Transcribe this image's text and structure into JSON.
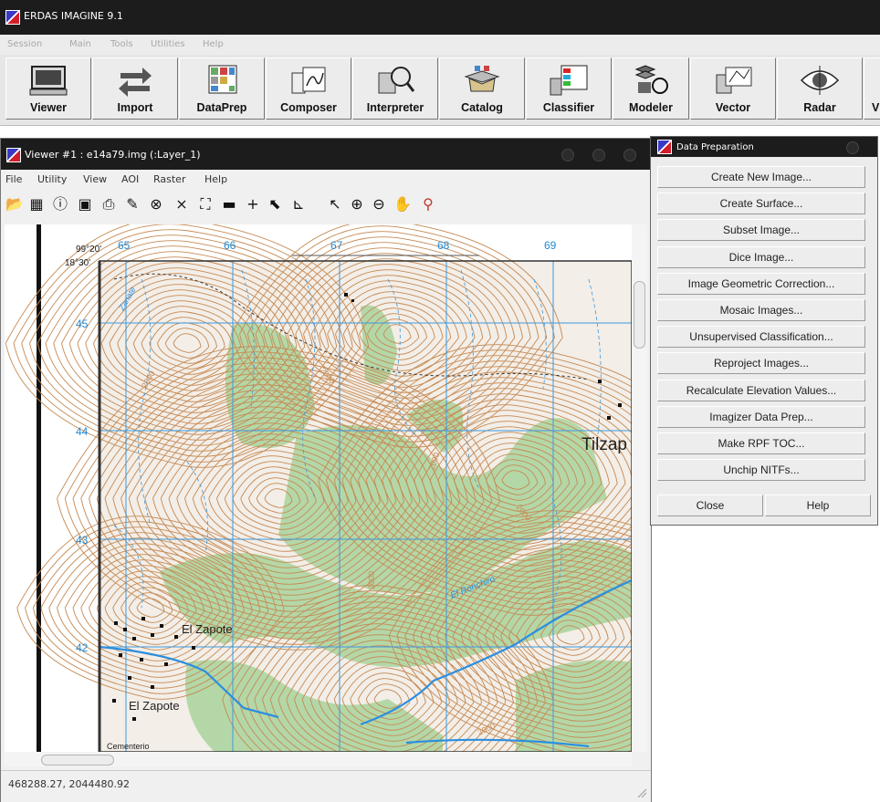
{
  "app": {
    "title": "ERDAS IMAGINE 9.1",
    "menu": [
      "Session",
      "Main",
      "Tools",
      "Utilities",
      "Help"
    ],
    "toolbar": [
      {
        "label": "Viewer",
        "icon": "monitor-icon"
      },
      {
        "label": "Import",
        "icon": "import-arrows-icon"
      },
      {
        "label": "DataPrep",
        "icon": "dataprep-grid-icon"
      },
      {
        "label": "Composer",
        "icon": "map-composer-icon"
      },
      {
        "label": "Interpreter",
        "icon": "magnifier-grid-icon"
      },
      {
        "label": "Catalog",
        "icon": "catalog-tray-icon"
      },
      {
        "label": "Classifier",
        "icon": "classifier-legend-icon"
      },
      {
        "label": "Modeler",
        "icon": "modeler-shapes-icon"
      },
      {
        "label": "Vector",
        "icon": "vector-grid-icon"
      },
      {
        "label": "Radar",
        "icon": "radar-eye-icon"
      },
      {
        "label": "V",
        "icon": "truncated-icon"
      }
    ]
  },
  "viewer": {
    "title": "Viewer #1 : e14a79.img (:Layer_1)",
    "menu": [
      "File",
      "Utility",
      "View",
      "AOI",
      "Raster",
      "Help"
    ],
    "tools": [
      {
        "name": "open-folder-icon",
        "glyph": "📂"
      },
      {
        "name": "open-layer-icon",
        "glyph": "▦"
      },
      {
        "name": "info-icon",
        "glyph": "ⓘ"
      },
      {
        "name": "save-icon",
        "glyph": "▣"
      },
      {
        "name": "print-icon",
        "glyph": "⎙"
      },
      {
        "name": "eraser-icon",
        "glyph": "✎"
      },
      {
        "name": "rotate-icon",
        "glyph": "⊗"
      },
      {
        "name": "zoom-fit-in-icon",
        "glyph": "⨯"
      },
      {
        "name": "zoom-fit-out-icon",
        "glyph": "⛶"
      },
      {
        "name": "measure-icon",
        "glyph": "▬"
      },
      {
        "name": "crosshair-icon",
        "glyph": "+"
      },
      {
        "name": "arrow-tool-icon",
        "glyph": "⬉"
      },
      {
        "name": "profile-icon",
        "glyph": "⊾"
      },
      {
        "name": "select-pointer-icon",
        "glyph": "↖"
      },
      {
        "name": "zoom-in-icon",
        "glyph": "⊕"
      },
      {
        "name": "zoom-out-icon",
        "glyph": "⊖"
      },
      {
        "name": "pan-hand-icon",
        "glyph": "✋"
      },
      {
        "name": "inquire-cursor-icon",
        "glyph": "⚲"
      }
    ],
    "status": "468288.27, 2044480.92",
    "map": {
      "corner_lon": "99°20'",
      "corner_lat": "18°30'",
      "top_grid_labels": [
        "65",
        "66",
        "67",
        "68",
        "69"
      ],
      "left_grid_labels": [
        "45",
        "44",
        "43",
        "42"
      ],
      "places": [
        "El Zapote",
        "El Zapote",
        "Tilzap",
        "El Ronchiro",
        "Cementerio",
        "Zanate"
      ],
      "contour_labels": [
        "2000",
        "2000",
        "2000",
        "2000",
        "2000",
        "2000"
      ],
      "colors": {
        "grid": "#3b9ae0",
        "contour": "#c58a54",
        "vegetation": "#a8d29b",
        "grid_label": "#1f8ad8"
      }
    }
  },
  "dataprep": {
    "title": "Data Preparation",
    "buttons": [
      "Create New Image...",
      "Create Surface...",
      "Subset Image...",
      "Dice Image...",
      "Image Geometric Correction...",
      "Mosaic Images...",
      "Unsupervised Classification...",
      "Reproject Images...",
      "Recalculate Elevation Values...",
      "Imagizer Data Prep...",
      "Make RPF TOC...",
      "Unchip NITFs..."
    ],
    "close": "Close",
    "help": "Help"
  }
}
